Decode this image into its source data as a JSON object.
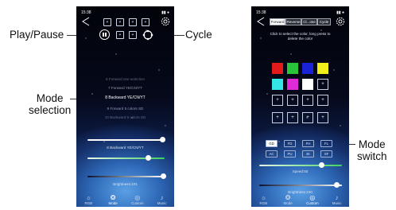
{
  "annotations": {
    "play_pause": "Play/Pause",
    "cycle": "Cycle",
    "mode_selection": "Mode\nselection",
    "mode_switch": "Mode\nswitch"
  },
  "left_phone": {
    "status_time": "15:38",
    "status_right": "▮▮ ●",
    "slots": [
      "+",
      "+",
      "+",
      "+",
      "+",
      "+"
    ],
    "modes": [
      {
        "label": "8 Forward one selection",
        "selected": false
      },
      {
        "label": "7 Forward YE/CN/YT",
        "selected": false
      },
      {
        "label": "8 Backward YE/CN/YT",
        "selected": true
      },
      {
        "label": "9 Forward 5 colors SD",
        "selected": false
      },
      {
        "label": "10 Backward 5 colors SD",
        "selected": false
      }
    ],
    "speed_label": "8 Backward YE/CN/YT",
    "speed_level": 0.95,
    "color_level": 0.78,
    "brightness_label": "Brightness:101",
    "brightness_level": 0.98,
    "nav": [
      {
        "icon": "☼",
        "label": "RGB",
        "active": false
      },
      {
        "icon": "❂",
        "label": "Mode",
        "active": true
      },
      {
        "icon": "◎",
        "label": "Custom",
        "active": false
      },
      {
        "icon": "♪",
        "label": "Music",
        "active": false
      }
    ]
  },
  "right_phone": {
    "status_time": "15:38",
    "status_right": "▮▮ ●",
    "tabs": [
      {
        "label": "Forward",
        "active": true
      },
      {
        "label": "Reverse",
        "active": false
      },
      {
        "label": "Cl...ose",
        "active": false
      },
      {
        "label": "Cycle",
        "active": false
      }
    ],
    "instruction": "Click to select the color, long press to delete the color",
    "swatch_colors": [
      "#e11b1b",
      "#29c43a",
      "#1a22d6",
      "#f2ee1a",
      "#35e6e6",
      "#e02bd9",
      "#ffffff"
    ],
    "empty_slot_symbol": "+",
    "mode_buttons_row1": [
      {
        "label": "GD",
        "active": true
      },
      {
        "label": "FD",
        "active": false
      },
      {
        "label": "FH",
        "active": false
      },
      {
        "label": "FL",
        "active": false
      }
    ],
    "mode_buttons_row2": [
      {
        "label": "AC",
        "active": false
      },
      {
        "label": "PU",
        "active": false
      },
      {
        "label": "BI",
        "active": false
      },
      {
        "label": "SF",
        "active": false
      }
    ],
    "speed_label": "Speed:50",
    "speed_level": 0.62,
    "brightness_label": "Brightness:100",
    "brightness_level": 0.95,
    "nav": [
      {
        "icon": "☼",
        "label": "RGB",
        "active": false
      },
      {
        "icon": "❂",
        "label": "Mode",
        "active": false
      },
      {
        "icon": "◎",
        "label": "Custom",
        "active": true
      },
      {
        "icon": "♪",
        "label": "Music",
        "active": false
      }
    ]
  }
}
